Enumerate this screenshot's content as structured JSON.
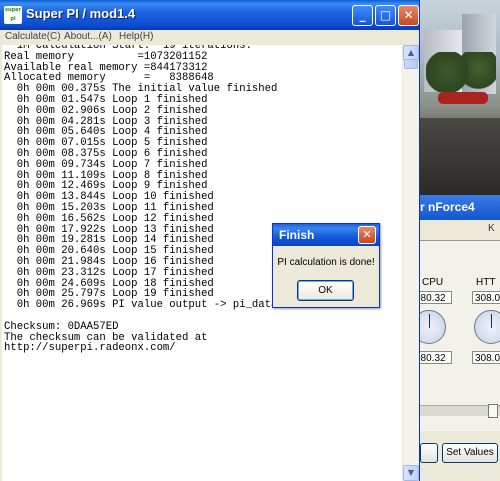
{
  "superpi": {
    "title": "Super PI / mod1.4",
    "icon_label": "super pi",
    "menu": [
      "Calculate(C)",
      "About...(A)",
      "Help(H)"
    ],
    "output": "  1M Calculation Start.  19 iterations.\nReal memory          =1073201152\nAvailable real memory =844173312\nAllocated memory      =   8388648\n  0h 00m 00.375s The initial value finished\n  0h 00m 01.547s Loop 1 finished\n  0h 00m 02.906s Loop 2 finished\n  0h 00m 04.281s Loop 3 finished\n  0h 00m 05.640s Loop 4 finished\n  0h 00m 07.015s Loop 5 finished\n  0h 00m 08.375s Loop 6 finished\n  0h 00m 09.734s Loop 7 finished\n  0h 00m 11.109s Loop 8 finished\n  0h 00m 12.469s Loop 9 finished\n  0h 00m 13.844s Loop 10 finished\n  0h 00m 15.203s Loop 11 finished\n  0h 00m 16.562s Loop 12 finished\n  0h 00m 17.922s Loop 13 finished\n  0h 00m 19.281s Loop 14 finished\n  0h 00m 20.640s Loop 15 finished\n  0h 00m 21.984s Loop 16 finished\n  0h 00m 23.312s Loop 17 finished\n  0h 00m 24.609s Loop 18 finished\n  0h 00m 25.797s Loop 19 finished\n  0h 00m 26.969s PI value output -> pi_data.txt\n\nChecksum: 0DAA57ED\nThe checksum can be validated at\nhttp://superpi.radeonx.com/"
  },
  "nforce": {
    "title": "r nForce4",
    "tab_partial": "K",
    "headers": [
      "CPU",
      "HTT"
    ],
    "values_top": [
      "080.32",
      "308.03"
    ],
    "values_bottom": [
      "080.32",
      "308.03"
    ],
    "set_values_label": "Set Values"
  },
  "dialog": {
    "title": "Finish",
    "message": "PI calculation is done!",
    "ok_label": "OK"
  },
  "titlebar_glyphs": {
    "minimize": "_",
    "maximize": "□",
    "close": "✕"
  },
  "colors": {
    "title_blue": "#0b4ccf",
    "close_red": "#c74621",
    "window_face": "#ece9d8"
  }
}
